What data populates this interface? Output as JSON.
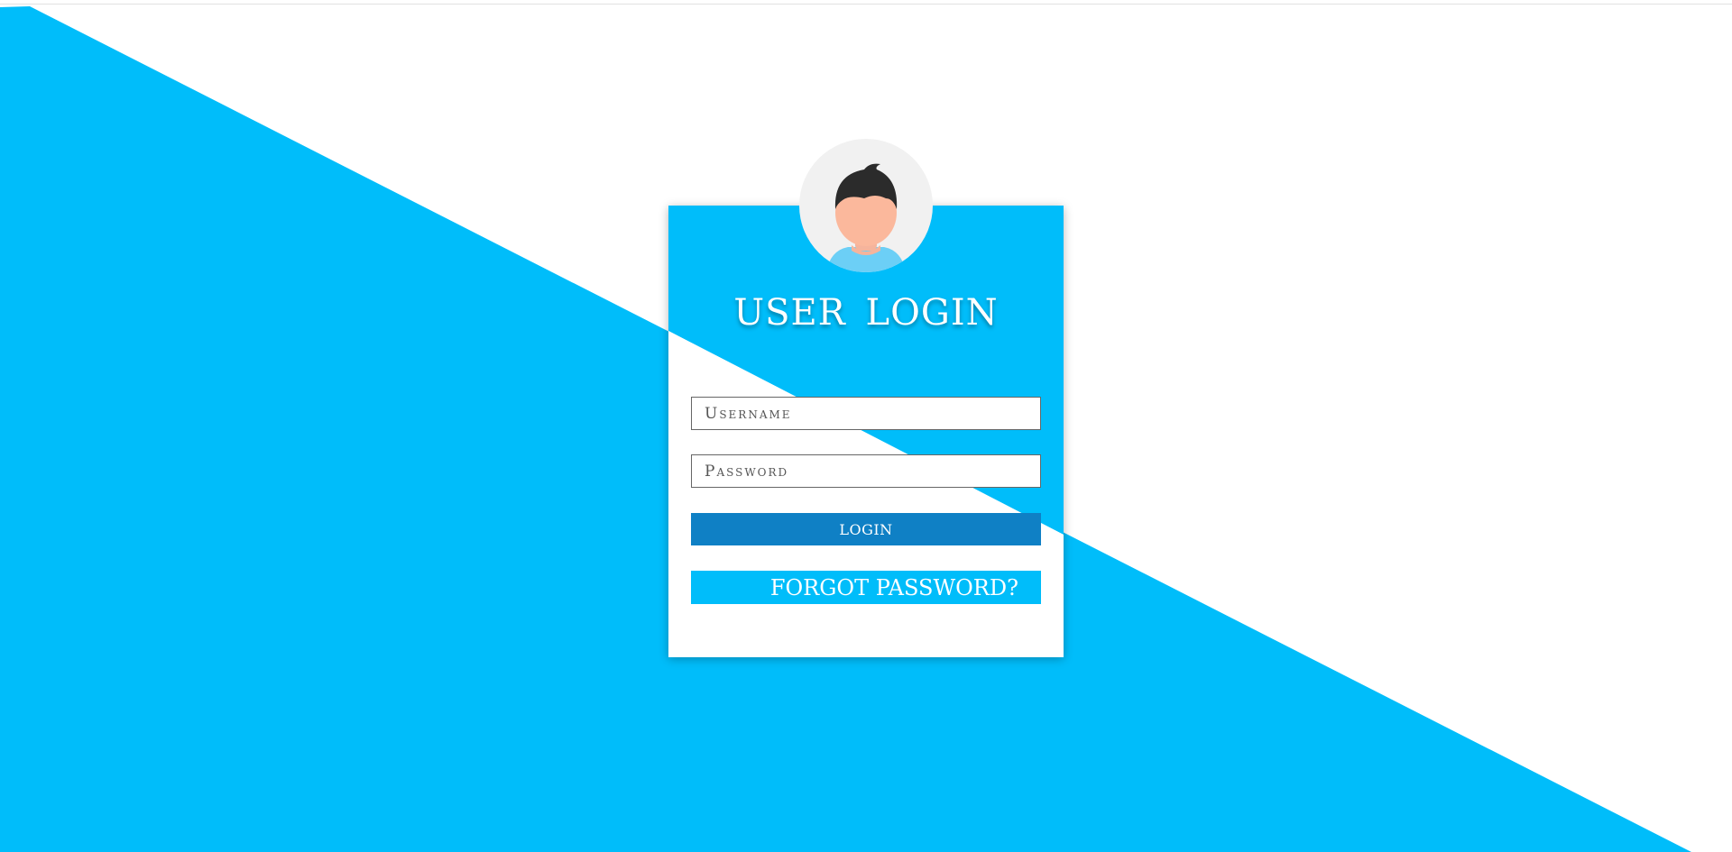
{
  "colors": {
    "accent": "#00bdfa",
    "button": "#0f80c5",
    "background": "#ffffff"
  },
  "login_card": {
    "avatar_icon": "user-avatar-icon",
    "title": "USER  LOGIN",
    "username_placeholder": "Username",
    "password_placeholder": "Password",
    "login_label": "LOGIN",
    "forgot_label": "FORGOT PASSWORD?"
  }
}
